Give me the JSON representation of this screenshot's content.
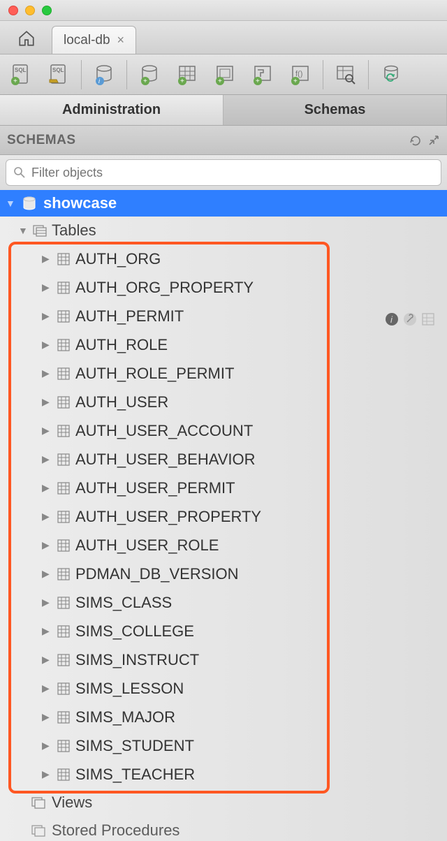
{
  "window": {
    "tab_label": "local-db"
  },
  "maintabs": {
    "administration": "Administration",
    "schemas": "Schemas"
  },
  "schemas_panel": {
    "title": "SCHEMAS",
    "filter_placeholder": "Filter objects"
  },
  "tree": {
    "database": "showcase",
    "tables_label": "Tables",
    "views_label": "Views",
    "stored_procedures_label": "Stored Procedures",
    "tables": [
      "AUTH_ORG",
      "AUTH_ORG_PROPERTY",
      "AUTH_PERMIT",
      "AUTH_ROLE",
      "AUTH_ROLE_PERMIT",
      "AUTH_USER",
      "AUTH_USER_ACCOUNT",
      "AUTH_USER_BEHAVIOR",
      "AUTH_USER_PERMIT",
      "AUTH_USER_PROPERTY",
      "AUTH_USER_ROLE",
      "PDMAN_DB_VERSION",
      "SIMS_CLASS",
      "SIMS_COLLEGE",
      "SIMS_INSTRUCT",
      "SIMS_LESSON",
      "SIMS_MAJOR",
      "SIMS_STUDENT",
      "SIMS_TEACHER"
    ]
  }
}
